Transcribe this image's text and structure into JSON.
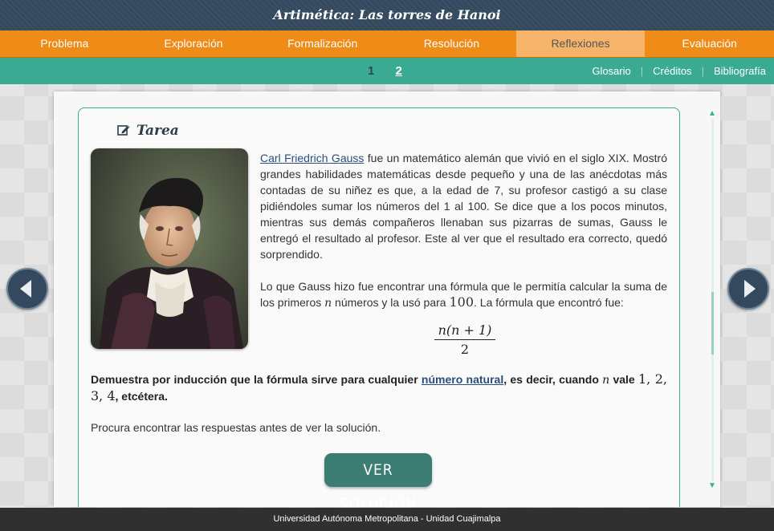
{
  "app": {
    "title": "Artimética: Las torres de Hanoi"
  },
  "nav": {
    "tabs": [
      {
        "label": "Problema"
      },
      {
        "label": "Exploración"
      },
      {
        "label": "Formalización"
      },
      {
        "label": "Resolución"
      },
      {
        "label": "Reflexiones",
        "active": true
      },
      {
        "label": "Evaluación"
      }
    ]
  },
  "subnav": {
    "pages": [
      "1",
      "2"
    ],
    "current_page": "1",
    "links": [
      "Glosario",
      "Créditos",
      "Bibliografía"
    ]
  },
  "content": {
    "section_title": "Tarea",
    "section_icon": "edit-icon",
    "portrait_icon": "gauss-portrait",
    "para1_link": "Carl Friedrich Gauss",
    "para1_text": " fue un matemático alemán que vivió en el siglo XIX. Mostró grandes habilidades matemáticas desde pequeño y una de las anécdotas más contadas de su niñez es que, a la edad de 7, su profesor castigó a su clase pidiéndoles sumar los números del 1 al 100. Se dice que a los pocos minutos, mientras sus demás compañeros llenaban sus pizarras de sumas, Gauss le entregó el resultado al profesor. Este al ver que el resultado era correcto, quedó sorprendido.",
    "para2_a": "Lo que Gauss hizo fue encontrar una fórmula que le permitía calcular la suma de los primeros ",
    "para2_var": "n",
    "para2_b": " números y la usó para ",
    "para2_num": "100",
    "para2_c": ". La fórmula que encontró fue:",
    "formula_numerator": "n(n + 1)",
    "formula_denominator": "2",
    "task_a": "Demuestra por inducción que la fórmula sirve para cualquier ",
    "task_link": "número natural",
    "task_b": ", es decir, cuando ",
    "task_var": "n",
    "task_c": " vale ",
    "task_values": "1, 2, 3, 4",
    "task_d": ", etcétera.",
    "hint": "Procura encontrar las respuestas antes de ver la solución.",
    "solution_button": "VER SOLUCIÓN"
  },
  "footer": {
    "text": "Universidad Autónoma Metropolitana - Unidad Cuajimalpa"
  },
  "colors": {
    "header": "#34495e",
    "nav": "#ef8b17",
    "nav_active": "#f6b46b",
    "subnav": "#3aab92",
    "button": "#3b7d73",
    "footer": "#303030"
  }
}
